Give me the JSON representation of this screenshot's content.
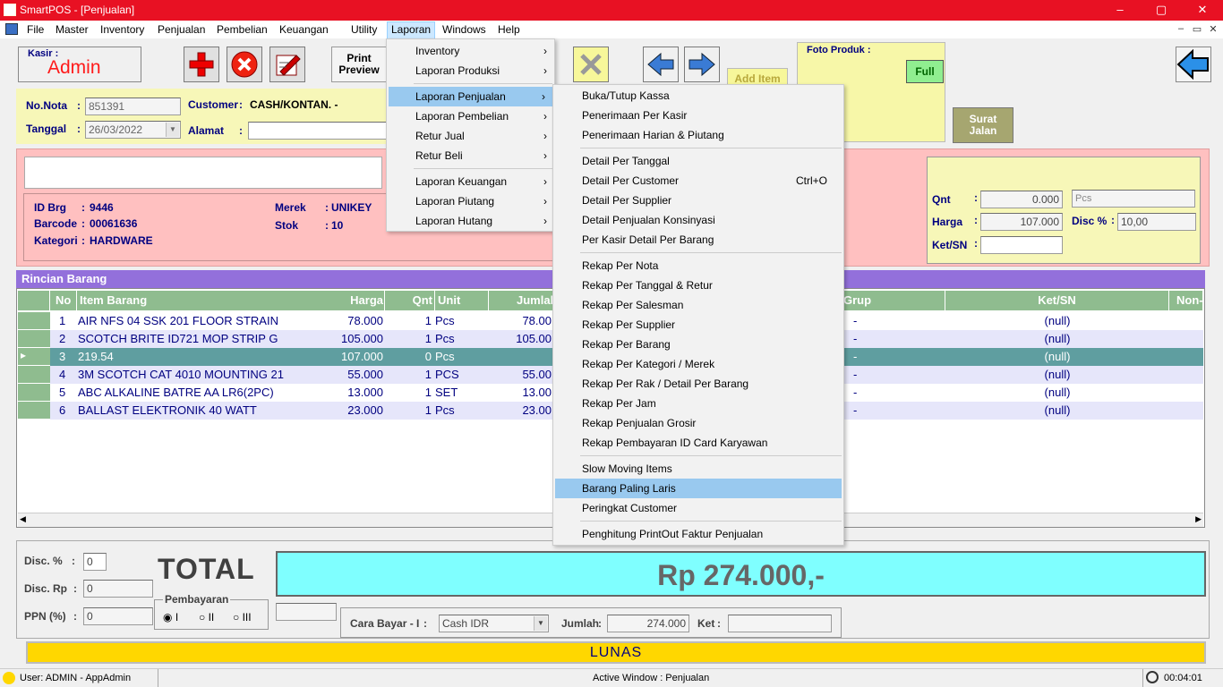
{
  "window": {
    "title": "SmartPOS - [Penjualan]",
    "controls": [
      "–",
      "▢",
      "✕"
    ]
  },
  "menubar": {
    "items": [
      "File",
      "Master",
      "Inventory",
      "Penjualan",
      "Pembelian",
      "Keuangan",
      "Utility",
      "Laporan",
      "Windows",
      "Help"
    ],
    "active": "Laporan",
    "mdi_controls": [
      "–",
      "▭",
      "✕"
    ]
  },
  "toolbar": {
    "kasir_label": "Kasir :",
    "kasir_value": "Admin",
    "print_label_1": "Print",
    "print_label_2": "Preview",
    "add_item": "Add Item",
    "foto_label": "Foto Produk :",
    "full_label": "Full",
    "surat_1": "Surat",
    "surat_2": "Jalan"
  },
  "header": {
    "nota_label": "No.Nota",
    "nota_value": "851391",
    "tanggal_label": "Tanggal",
    "tanggal_value": "26/03/2022",
    "customer_label": "Customer",
    "customer_value": "CASH/KONTAN. -",
    "alamat_label": "Alamat",
    "alamat_value": ""
  },
  "item": {
    "id_label": "ID Brg",
    "id_value": "9446",
    "barcode_label": "Barcode",
    "barcode_value": "00061636",
    "kategori_label": "Kategori",
    "kategori_value": "HARDWARE",
    "merek_label": "Merek",
    "merek_value": "UNIKEY",
    "stok_label": "Stok",
    "stok_value": "10",
    "qnt_label": "Qnt",
    "qnt_value": "0.000",
    "unit_value": "Pcs",
    "harga_label": "Harga",
    "harga_value": "107.000",
    "disc_label": "Disc %",
    "disc_value": "10,00",
    "ketsn_label": "Ket/SN",
    "ketsn_value": ""
  },
  "grid": {
    "title": "Rincian Barang",
    "columns": [
      "No",
      "Item Barang",
      "Harga",
      "Qnt",
      "Unit",
      "Jumlah",
      "Grup",
      "Ket/SN",
      "Non-"
    ],
    "rows": [
      {
        "no": "1",
        "item": "AIR NFS 04 SSK 201 FLOOR STRAIN",
        "harga": "78.000",
        "qnt": "1",
        "unit": "Pcs",
        "jumlah": "78.00",
        "grup": "-",
        "ket": "(null)"
      },
      {
        "no": "2",
        "item": "SCOTCH BRITE ID721 MOP STRIP G",
        "harga": "105.000",
        "qnt": "1",
        "unit": "Pcs",
        "jumlah": "105.00",
        "grup": "-",
        "ket": "(null)"
      },
      {
        "no": "3",
        "item": "219.54",
        "harga": "107.000",
        "qnt": "0",
        "unit": "Pcs",
        "jumlah": "",
        "grup": "-",
        "ket": "(null)"
      },
      {
        "no": "4",
        "item": "3M SCOTCH CAT 4010 MOUNTING 21",
        "harga": "55.000",
        "qnt": "1",
        "unit": "PCS",
        "jumlah": "55.00",
        "grup": "-",
        "ket": "(null)"
      },
      {
        "no": "5",
        "item": "ABC ALKALINE BATRE AA LR6(2PC)",
        "harga": "13.000",
        "qnt": "1",
        "unit": "SET",
        "jumlah": "13.00",
        "grup": "-",
        "ket": "(null)"
      },
      {
        "no": "6",
        "item": "BALLAST ELEKTRONIK 40 WATT",
        "harga": "23.000",
        "qnt": "1",
        "unit": "Pcs",
        "jumlah": "23.00",
        "grup": "-",
        "ket": "(null)"
      }
    ],
    "selected_row": 3
  },
  "bottom": {
    "disc_pct_label": "Disc. %",
    "disc_pct_value": "0",
    "disc_rp_label": "Disc. Rp",
    "disc_rp_value": "0",
    "ppn_label": "PPN (%)",
    "ppn_value": "0",
    "total_label": "TOTAL",
    "total_value": "Rp 274.000,-",
    "pembayaran_label": "Pembayaran",
    "pembayaran_options": [
      "I",
      "II",
      "III"
    ],
    "cara_label": "Cara Bayar - I",
    "cara_value": "Cash IDR",
    "jumlah_label": "Jumlah",
    "jumlah_value": "274.000",
    "ket_label": "Ket",
    "ket_value": "",
    "status": "LUNAS"
  },
  "statusbar": {
    "user": "User: ADMIN - AppAdmin",
    "active_window": "Active Window : Penjualan",
    "clock": "00:04:01"
  },
  "laporan_menu": [
    {
      "label": "Inventory",
      "sub": true
    },
    {
      "label": "Laporan Produksi",
      "sub": true
    },
    {
      "sep": true
    },
    {
      "label": "Laporan Penjualan",
      "sub": true,
      "highlight": true
    },
    {
      "label": "Laporan Pembelian",
      "sub": true
    },
    {
      "label": "Retur Jual",
      "sub": true
    },
    {
      "label": "Retur Beli",
      "sub": true
    },
    {
      "sep": true
    },
    {
      "label": "Laporan Keuangan",
      "sub": true
    },
    {
      "label": "Laporan Piutang",
      "sub": true
    },
    {
      "label": "Laporan Hutang",
      "sub": true
    }
  ],
  "penjualan_menu": [
    {
      "label": "Buka/Tutup Kassa"
    },
    {
      "label": "Penerimaan Per Kasir"
    },
    {
      "label": "Penerimaan Harian & Piutang"
    },
    {
      "sep": true
    },
    {
      "label": "Detail Per Tanggal"
    },
    {
      "label": "Detail Per Customer",
      "shortcut": "Ctrl+O"
    },
    {
      "label": "Detail Per Supplier"
    },
    {
      "label": "Detail Penjualan Konsinyasi"
    },
    {
      "label": "Per Kasir Detail Per Barang"
    },
    {
      "sep": true
    },
    {
      "label": "Rekap Per Nota"
    },
    {
      "label": "Rekap Per Tanggal & Retur"
    },
    {
      "label": "Rekap Per Salesman"
    },
    {
      "label": "Rekap Per Supplier"
    },
    {
      "label": "Rekap Per Barang"
    },
    {
      "label": "Rekap Per Kategori / Merek"
    },
    {
      "label": "Rekap Per Rak / Detail Per Barang"
    },
    {
      "label": "Rekap Per Jam"
    },
    {
      "label": "Rekap Penjualan Grosir"
    },
    {
      "label": "Rekap Pembayaran ID Card Karyawan"
    },
    {
      "sep": true
    },
    {
      "label": "Slow Moving Items"
    },
    {
      "label": "Barang Paling Laris",
      "highlight": true
    },
    {
      "label": "Peringkat Customer"
    },
    {
      "sep": true
    },
    {
      "label": "Penghitung PrintOut Faktur Penjualan"
    }
  ]
}
